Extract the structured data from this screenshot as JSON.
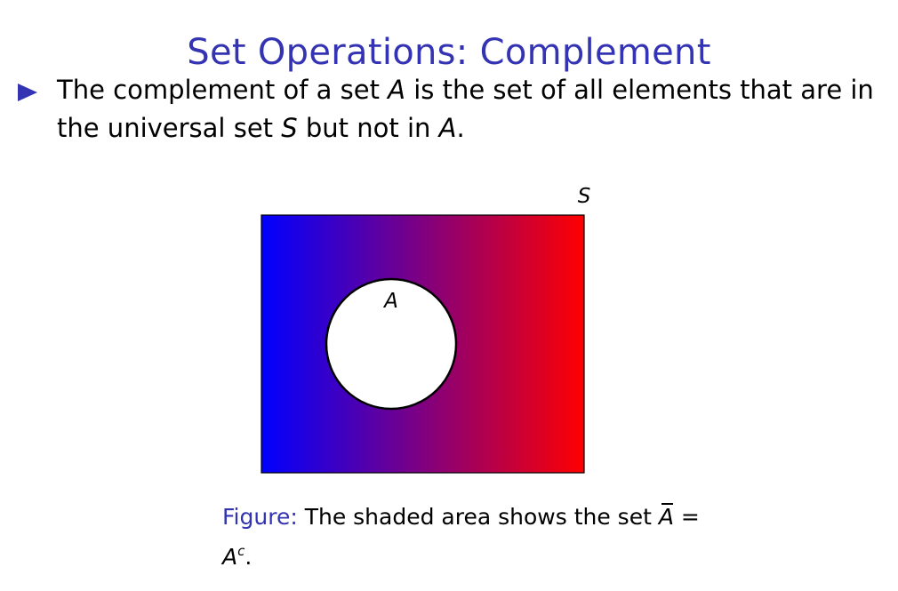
{
  "slide": {
    "title": "Set Operations: Complement"
  },
  "bullet": {
    "part1": "The complement of a set ",
    "var_a1": "A",
    "part2": " is the set of all elements that are in the universal set ",
    "var_s": "S",
    "part3": " but not in ",
    "var_a2": "A",
    "part4": "."
  },
  "figure": {
    "universe_label": "S",
    "set_label": "A",
    "colors": {
      "gradient_left": "#0000ff",
      "gradient_right": "#ff0000",
      "circle_fill": "#ffffff",
      "outline": "#000000"
    }
  },
  "caption": {
    "label": "Figure:",
    "text_before": " The shaded area shows the set ",
    "a_bar": "A",
    "equals": " = ",
    "a": "A",
    "superscript": "c",
    "period": "."
  },
  "colors": {
    "accent": "#3333b3",
    "text": "#000000",
    "background": "#ffffff"
  }
}
